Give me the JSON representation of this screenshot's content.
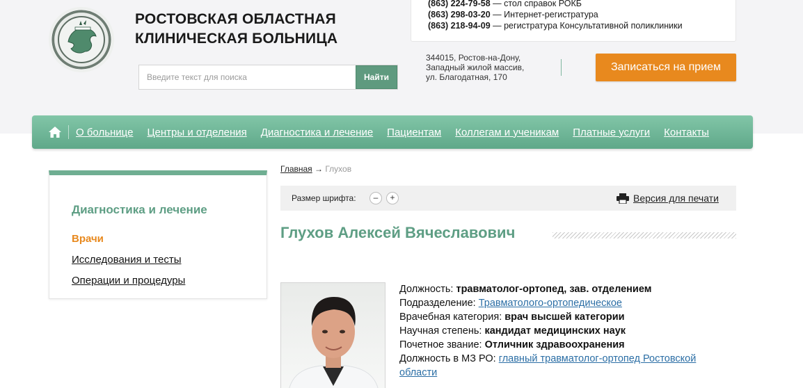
{
  "header": {
    "title_line1": "РОСТОВСКАЯ ОБЛАСТНАЯ",
    "title_line2": "КЛИНИЧЕСКАЯ БОЛЬНИЦА",
    "search_placeholder": "Введите текст для поиска",
    "search_button": "Найти",
    "phones": [
      {
        "number": "(863) 224-79-58",
        "desc": " — стол справок РОКБ"
      },
      {
        "number": "(863) 298-03-20",
        "desc": " — Интернет-регистратура"
      },
      {
        "number": "(863) 218-94-09",
        "desc": " — регистратура Консультативной поликлиники"
      }
    ],
    "address_line1": "344015, Ростов-на-Дону,",
    "address_line2": "Западный жилой массив,",
    "address_line3": "ул. Благодатная, 170",
    "appointment_button": "Записаться на прием"
  },
  "nav": {
    "items": [
      "О больнице",
      "Центры и отделения",
      "Диагностика и лечение",
      "Пациентам",
      "Коллегам и ученикам",
      "Платные услуги",
      "Контакты"
    ]
  },
  "sidebar": {
    "title": "Диагностика и лечение",
    "items": [
      "Врачи",
      "Исследования и тесты",
      "Операции и процедуры"
    ]
  },
  "breadcrumb": {
    "home": "Главная",
    "separator": " → ",
    "current": "Глухов"
  },
  "toolbar": {
    "font_size_label": "Размер шрифта:",
    "decrease": "–",
    "increase": "+",
    "print_label": "Версия для печати"
  },
  "doctor": {
    "name": "Глухов Алексей Вячеславович",
    "position_label": "Должность: ",
    "position_value": "травматолог-ортопед, зав. отделением",
    "department_label": "Подразделение: ",
    "department_value": "Травматолого-ортопедическое",
    "category_label": "Врачебная категория: ",
    "category_value": "врач высшей категории",
    "degree_label": "Научная степень: ",
    "degree_value": "кандидат медицинских наук",
    "title_label": "Почетное звание: ",
    "title_value": "Отличник здравоохранения",
    "mz_label": "Должность в МЗ РО: ",
    "mz_value": "главный травматолог-ортопед Ростовской области"
  },
  "colors": {
    "accent_green": "#5e9e84",
    "orange": "#e8891e",
    "link_blue": "#2b6ea5"
  }
}
